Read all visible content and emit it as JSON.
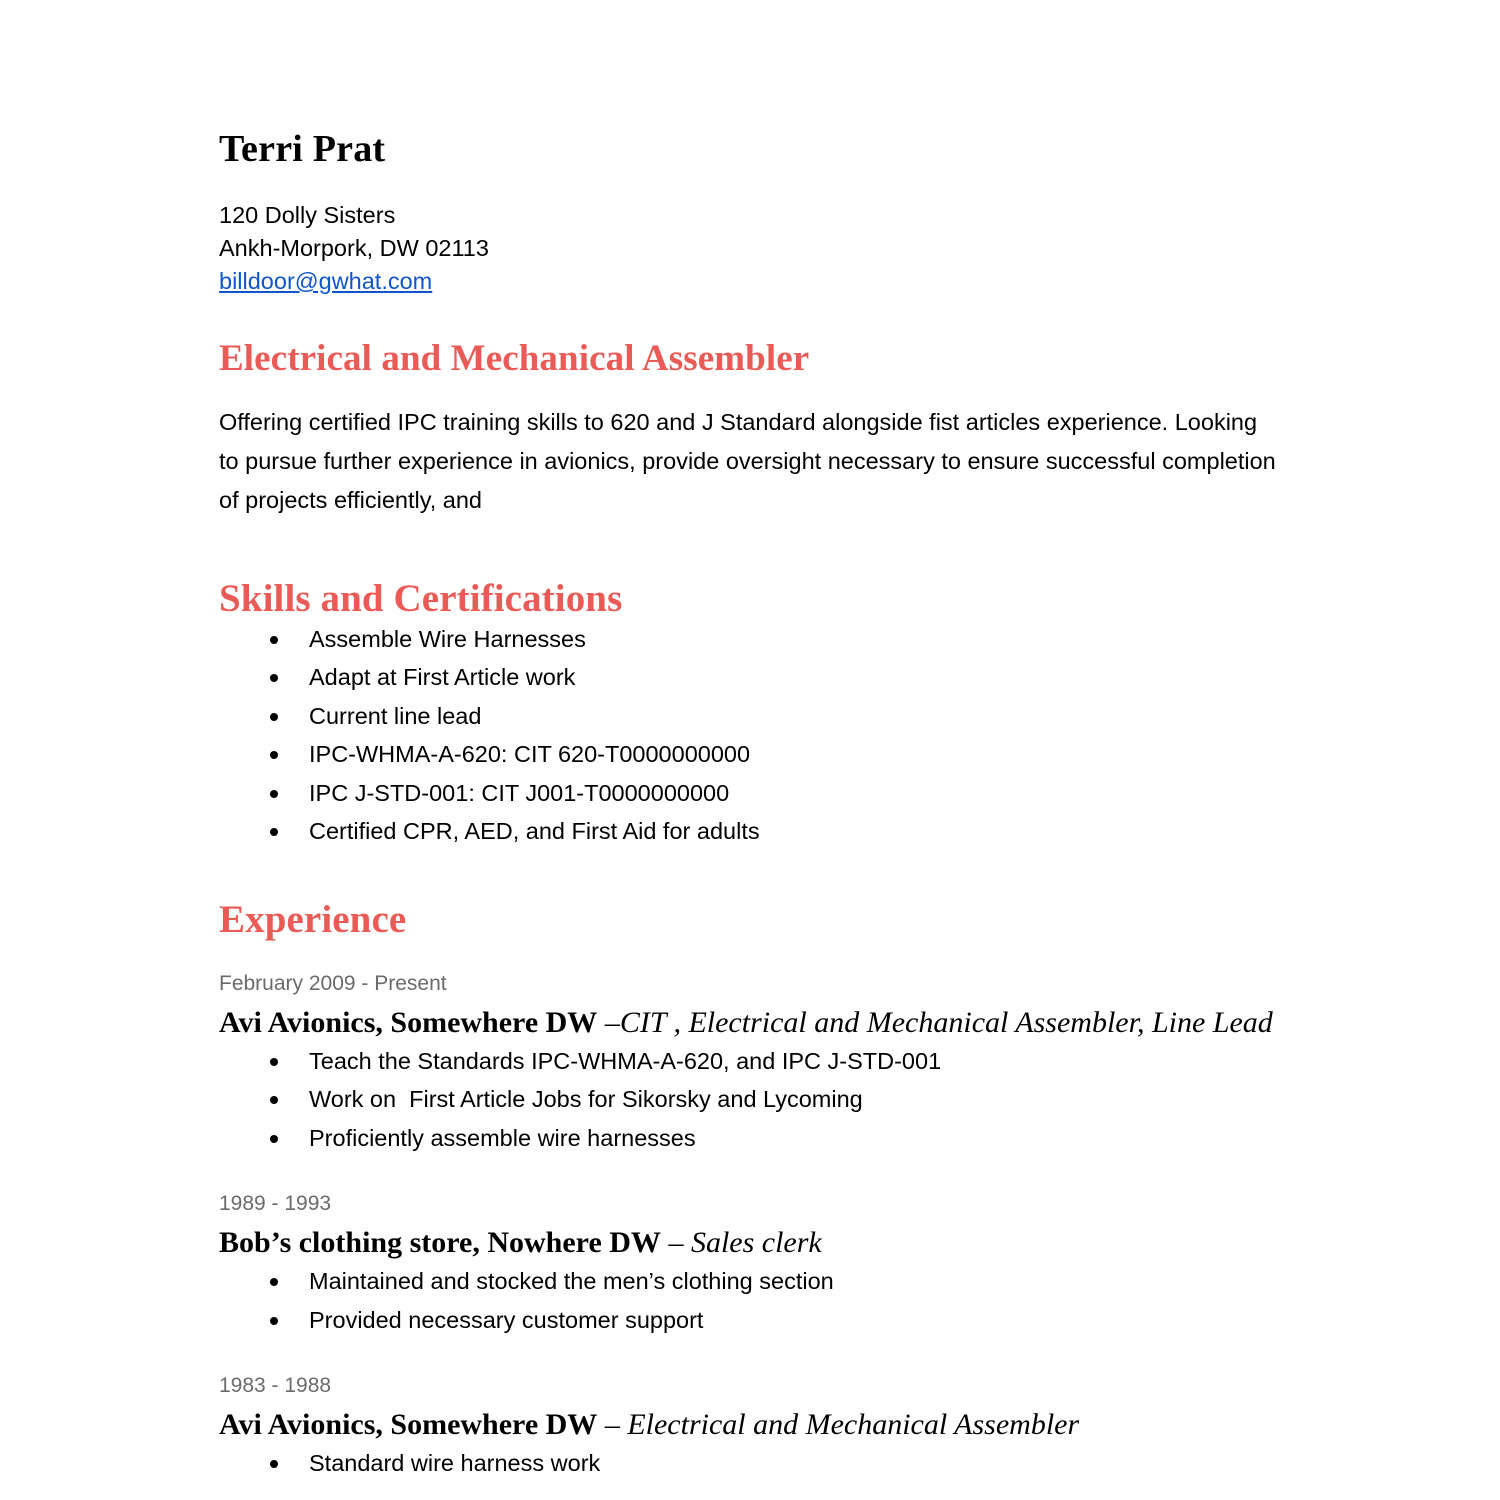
{
  "document": {
    "type": "resume",
    "accent_color": "#ea5b57",
    "link_color": "#1155cc",
    "muted_color": "#6b6b6b"
  },
  "header": {
    "name": "Terri Prat",
    "address_line1": "120 Dolly Sisters",
    "address_line2": "Ankh-Morpork, DW 02113",
    "email": "billdoor@gwhat.com"
  },
  "headline": {
    "title": "Electrical and Mechanical Assembler",
    "summary": "Offering certified IPC training skills to 620 and J Standard alongside fist articles experience. Looking to pursue further experience in avionics,  provide oversight necessary to ensure successful completion of projects efficiently, and"
  },
  "skills": {
    "heading": "Skills and Certifications",
    "items": [
      "Assemble Wire Harnesses",
      "Adapt at First Article work",
      "Current line lead",
      "IPC-WHMA-A-620: CIT 620-T0000000000",
      "IPC J-STD-001: CIT J001-T0000000000",
      "Certified CPR, AED, and First Aid for adults"
    ]
  },
  "experience": {
    "heading": "Experience",
    "jobs": [
      {
        "dates": "February 2009 - Present",
        "employer": "Avi Avionics, Somewhere DW",
        "role": " –CIT , Electrical and Mechanical Assembler, Line Lead",
        "bullets": [
          "Teach the Standards IPC-WHMA-A-620, and IPC J-STD-001",
          "Work on  First Article Jobs for Sikorsky and Lycoming",
          "Proficiently assemble wire harnesses"
        ]
      },
      {
        "dates": "1989 - 1993",
        "employer": "Bob’s clothing store, Nowhere DW",
        "role": " – Sales clerk",
        "bullets": [
          "Maintained and stocked the men’s clothing section",
          "Provided necessary customer support"
        ]
      },
      {
        "dates": "1983 - 1988",
        "employer": "Avi Avionics, Somewhere DW",
        "role": " – Electrical and Mechanical Assembler",
        "bullets": [
          "Standard wire harness work"
        ]
      }
    ]
  }
}
